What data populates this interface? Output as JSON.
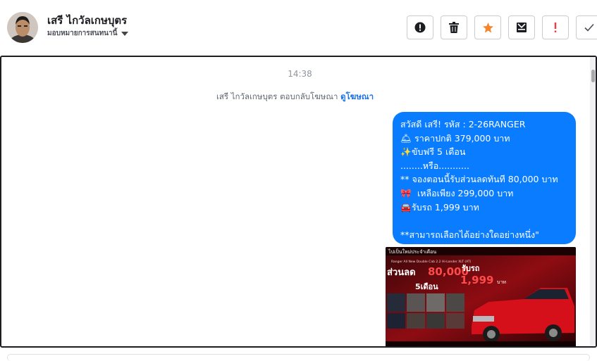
{
  "header": {
    "contact_name": "เสรี ไกวัลเกษบุตร",
    "assign_label": "มอบหมายการสนทนานี้",
    "actions": [
      {
        "icon": "exclamation-circle-icon"
      },
      {
        "icon": "trash-icon"
      },
      {
        "icon": "star-icon",
        "color": "#f5862e"
      },
      {
        "icon": "archive-icon"
      },
      {
        "icon": "exclamation-icon",
        "color": "#fa383e"
      },
      {
        "icon": "checkmark-icon"
      }
    ]
  },
  "conversation": {
    "timestamp": "14:38",
    "system_message": "เสรี ไกวัลเกษบุตร ตอบกลับโฆษณา",
    "system_link": "ดูโฆษณา",
    "message": {
      "lines": [
        "สวัสดี เสรี! รหัส : 2-26RANGER",
        "ราคาปกติ 379,000 บาท",
        "ขับฟรี 5 เดือน",
        "........หรือ...........",
        "** จองตอนนี้รับส่วนลดทันที 80,000 บาท",
        "เหลือเพียง 299,000 บาท",
        "รับรถ 1,999 บาท",
        "",
        "**สามารถเลือกได้อย่างใดอย่างหนึ่ง\""
      ],
      "emojis": [
        "",
        "🛎",
        "✨",
        "",
        "",
        "🎀",
        "🚘",
        "",
        ""
      ]
    },
    "ad_image": {
      "headline": "ไปเป็นใหม่ประจำเดือน",
      "strap": "Ranger All New Double Cab 2.2 Hi-Lander XLT (AT)",
      "promo_left": "ส่วนลด",
      "promo_amount": "80,000",
      "promo_months": "5เดือน",
      "promo_right": "รับรถ",
      "promo_price": "1,999",
      "promo_unit": "บาท",
      "accent_color": "#d6101b"
    }
  },
  "colors": {
    "bubble": "#0a7cff",
    "link": "#1b74e4"
  }
}
